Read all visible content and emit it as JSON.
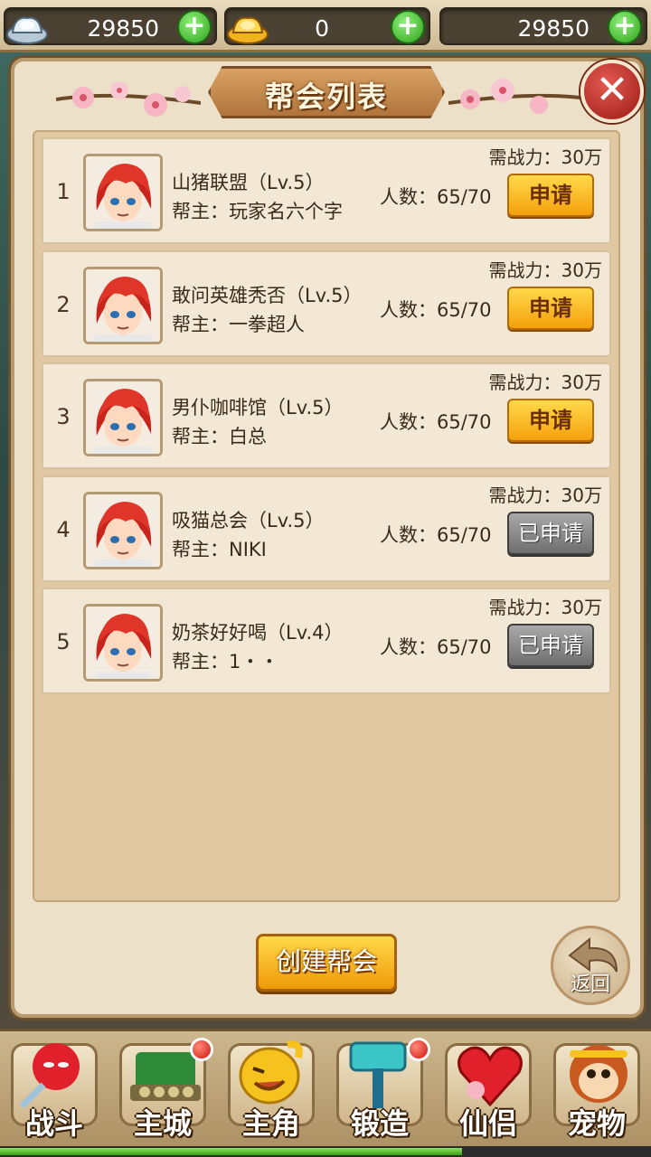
{
  "currency": {
    "silver": {
      "value": "29850",
      "icon": "silver-ingot-icon"
    },
    "gold": {
      "value": "0",
      "icon": "gold-ingot-icon"
    },
    "third": {
      "value": "29850"
    }
  },
  "panel": {
    "title": "帮会列表",
    "close_icon": "close-x-icon"
  },
  "guilds": [
    {
      "rank": "1",
      "name": "山猪联盟（Lv.5）",
      "leader": "帮主：玩家名六个字",
      "members": "人数：65/70",
      "requirement": "需战力：30万",
      "action": "申请",
      "status": "apply"
    },
    {
      "rank": "2",
      "name": "敢问英雄秃否（Lv.5）",
      "leader": "帮主：一拳超人",
      "members": "人数：65/70",
      "requirement": "需战力：30万",
      "action": "申请",
      "status": "apply"
    },
    {
      "rank": "3",
      "name": "男仆咖啡馆（Lv.5）",
      "leader": "帮主：白总",
      "members": "人数：65/70",
      "requirement": "需战力：30万",
      "action": "申请",
      "status": "apply"
    },
    {
      "rank": "4",
      "name": "吸猫总会（Lv.5）",
      "leader": "帮主：NIKI",
      "members": "人数：65/70",
      "requirement": "需战力：30万",
      "action": "已申请",
      "status": "applied"
    },
    {
      "rank": "5",
      "name": "奶茶好好喝（Lv.4）",
      "leader": "帮主：1・・",
      "members": "人数：65/70",
      "requirement": "需战力：30万",
      "action": "已申请",
      "status": "applied"
    }
  ],
  "create_button": "创建帮会",
  "back_button": "返回",
  "nav": [
    {
      "label": "战斗",
      "icon": "battle-ninja-icon",
      "badge": false
    },
    {
      "label": "主城",
      "icon": "city-gate-icon",
      "badge": true
    },
    {
      "label": "主角",
      "icon": "hero-face-icon",
      "badge": false
    },
    {
      "label": "锻造",
      "icon": "forge-hammer-icon",
      "badge": true
    },
    {
      "label": "仙侣",
      "icon": "heart-companion-icon",
      "badge": false
    },
    {
      "label": "宠物",
      "icon": "monkey-pet-icon",
      "badge": false
    }
  ],
  "progress": {
    "value": 0.71
  },
  "colors": {
    "apply_button": "#f5a00c",
    "applied_button": "#6e6e6e",
    "panel_bg": "#ece0c8",
    "list_bg": "#e0c9a2"
  }
}
